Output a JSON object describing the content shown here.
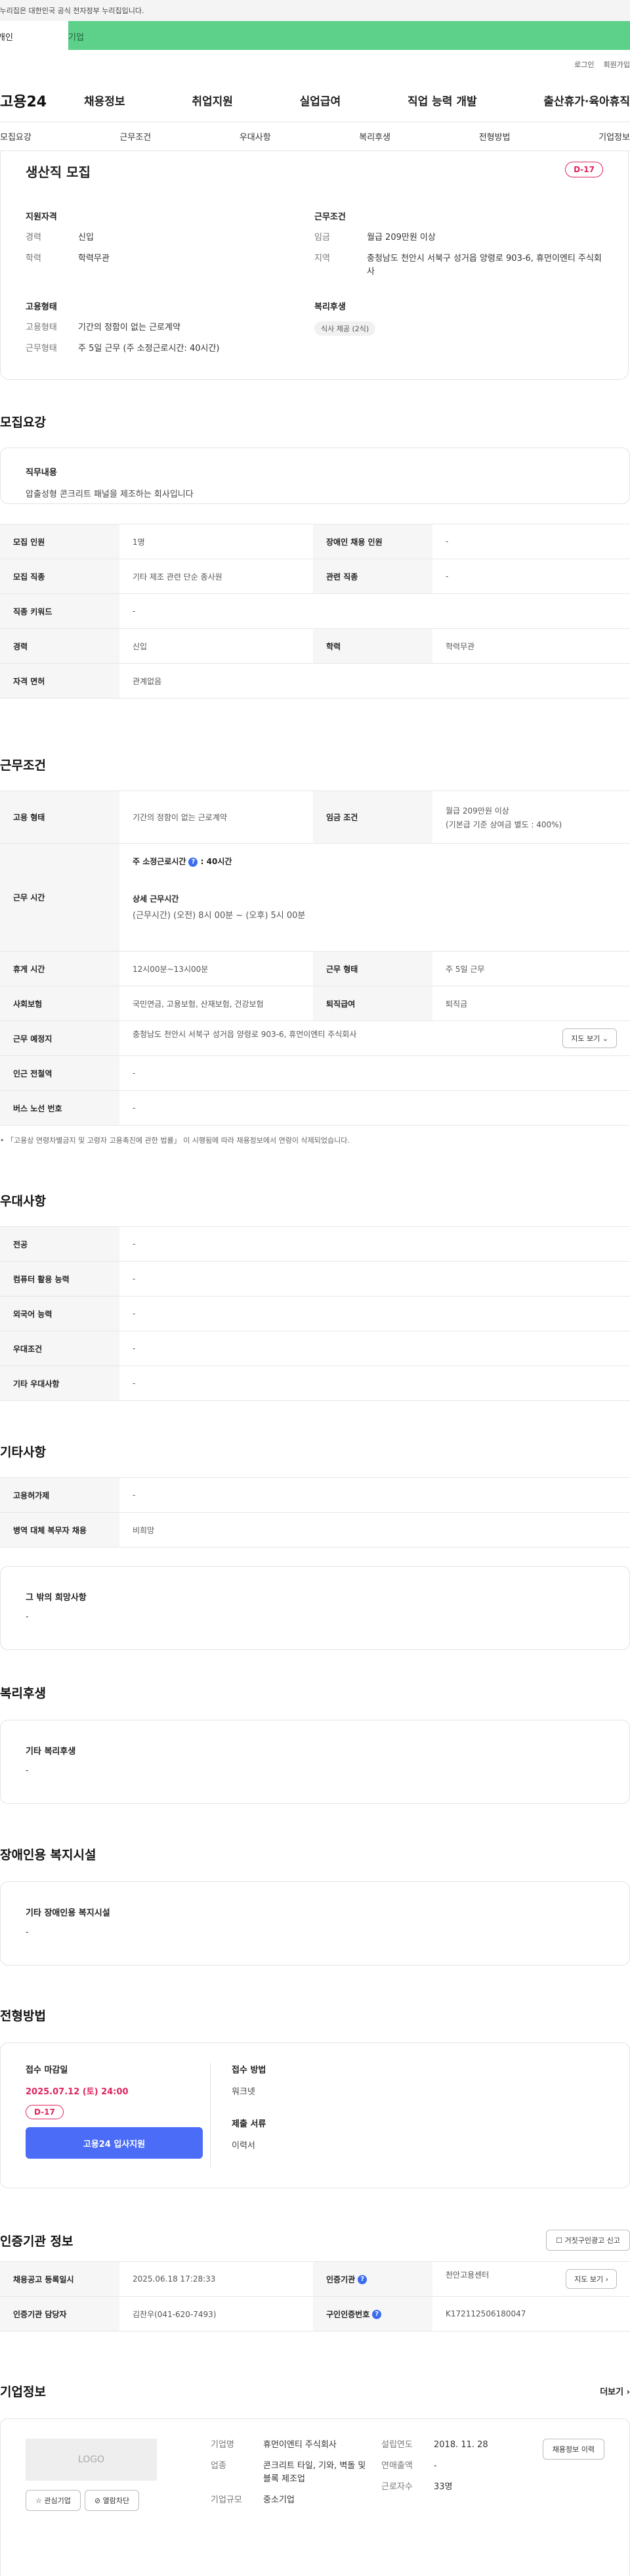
{
  "gov_banner": "이 누리집은 대한민국 공식 전자정부 누리집입니다.",
  "top_tabs": {
    "personal": "개인",
    "company": "기업"
  },
  "util": {
    "login": "로그인",
    "join": "회원가입"
  },
  "logo": "고용24",
  "gnb": [
    "채용정보",
    "취업지원",
    "실업급여",
    "직업 능력 개발",
    "출산휴가·육아휴직"
  ],
  "lnb": [
    "모집요강",
    "근무조건",
    "우대사항",
    "복리후생",
    "전형방법",
    "기업정보"
  ],
  "summary": {
    "title": "생산직 모집",
    "dday": "D-17",
    "qual": {
      "heading": "지원자격",
      "career_k": "경력",
      "career_v": "신입",
      "edu_k": "학력",
      "edu_v": "학력무관"
    },
    "cond": {
      "heading": "근무조건",
      "wage_k": "임금",
      "wage_v": "월급 209만원 이상",
      "loc_k": "지역",
      "loc_v": "충청남도 천안시 서북구 성거읍 양령로 903-6, 휴먼이엔티 주식회사"
    },
    "emp": {
      "heading": "고용형태",
      "type_k": "고용형태",
      "type_v": "기간의 정함이 없는 근로계약",
      "form_k": "근무형태",
      "form_v": "주 5일 근무 (주 소정근로시간: 40시간)"
    },
    "welfare": {
      "heading": "복리후생",
      "chip": "식사 제공 (2식)"
    }
  },
  "recruit": {
    "title": "모집요강",
    "duty_h": "직무내용",
    "duty_v": "압출성형 콘크리트 패널을 제조하는 회사입니다",
    "rows": {
      "headcount_k": "모집 인원",
      "headcount_v": "1명",
      "disabled_k": "장애인 채용 인원",
      "disabled_v": "-",
      "job_k": "모집 직종",
      "job_v": "기타 제조 관련 단순 종사원",
      "related_k": "관련 직종",
      "related_v": "-",
      "keyword_k": "직종 키워드",
      "keyword_v": "-",
      "career_k": "경력",
      "career_v": "신입",
      "edu_k": "학력",
      "edu_v": "학력무관",
      "license_k": "자격 면허",
      "license_v": "관계없음"
    }
  },
  "work": {
    "title": "근무조건",
    "emp_k": "고용 형태",
    "emp_v": "기간의 정함이 없는 근로계약",
    "wage_k": "임금 조건",
    "wage_v1": "월급 209만원 이상",
    "wage_v2": "(기본급 기준 상여금 별도 : 400%)",
    "hours_k": "근무 시간",
    "hours_weekly": "주 소정근로시간",
    "hours_weekly_v": ": 40시간",
    "hours_detail_h": "상세 근무시간",
    "hours_detail_v": "(근무시간) (오전) 8시 00분 ~ (오후) 5시 00분",
    "break_k": "휴게 시간",
    "break_v": "12시00분~13시00분",
    "form_k": "근무 형태",
    "form_v": "주 5일 근무",
    "insurance_k": "사회보험",
    "insurance_v": "국민연금, 고용보험, 산재보험, 건강보험",
    "retire_k": "퇴직급여",
    "retire_v": "퇴직금",
    "place_k": "근무 예정지",
    "place_v": "충청남도 천안시 서북구 성거읍 양령로 903-6, 휴먼이엔티 주식회사",
    "map_btn": "지도 보기",
    "subway_k": "인근 전철역",
    "subway_v": "-",
    "bus_k": "버스 노선 번호",
    "bus_v": "-",
    "note": "「고용상 연령차별금지 및 고령자 고용촉진에 관한 법률」 이 시행됨에 따라 채용정보에서 연령이 삭제되었습니다."
  },
  "pref": {
    "title": "우대사항",
    "major_k": "전공",
    "major_v": "-",
    "computer_k": "컴퓨터 활용 능력",
    "computer_v": "-",
    "lang_k": "외국어 능력",
    "lang_v": "-",
    "cond_k": "우대조건",
    "cond_v": "-",
    "etc_k": "기타 우대사항",
    "etc_v": "-"
  },
  "other": {
    "title": "기타사항",
    "permit_k": "고용허가제",
    "permit_v": "-",
    "military_k": "병역 대체 복무자 채용",
    "military_v": "비희망",
    "wish_h": "그 밖의 희망사항",
    "wish_v": "-"
  },
  "welfare": {
    "title": "복리후생",
    "h": "기타 복리후생",
    "v": "-"
  },
  "disabled_fac": {
    "title": "장애인용 복지시설",
    "h": "기타 장애인용 복지시설",
    "v": "-"
  },
  "selection": {
    "title": "전형방법",
    "deadline_h": "접수 마감일",
    "deadline_v": "2025.07.12 (토) 24:00",
    "dday": "D-17",
    "apply_btn": "고용24 입사지원",
    "method_h": "접수 방법",
    "method_v": "워크넷",
    "docs_h": "제출 서류",
    "docs_v": "이력서"
  },
  "cert": {
    "title": "인증기관 정보",
    "report_btn": "거짓구인광고 신고",
    "reg_k": "채용공고 등록일시",
    "reg_v": "2025.06.18 17:28:33",
    "org_k": "인증기관",
    "org_v": "천안고용센터",
    "map_btn": "지도 보기",
    "manager_k": "인증기관 담당자",
    "manager_v": "김찬우(041-620-7493)",
    "num_k": "구인인증번호",
    "num_v": "K172112506180047"
  },
  "company": {
    "title": "기업정보",
    "more": "더보기",
    "logo": "LOGO",
    "fav_btn": "관심기업",
    "block_btn": "열람차단",
    "name_k": "기업명",
    "name_v": "휴먼이엔티 주식회사",
    "industry_k": "업종",
    "industry_v": "콘크리트 타일, 기와, 벽돌 및 블록 제조업",
    "scale_k": "기업규모",
    "scale_v": "중소기업",
    "founded_k": "설립연도",
    "founded_v": "2018. 11. 28",
    "sales_k": "연매출액",
    "sales_v": "-",
    "staff_k": "근로자수",
    "staff_v": "33명",
    "history_btn": "채용정보 이력"
  }
}
